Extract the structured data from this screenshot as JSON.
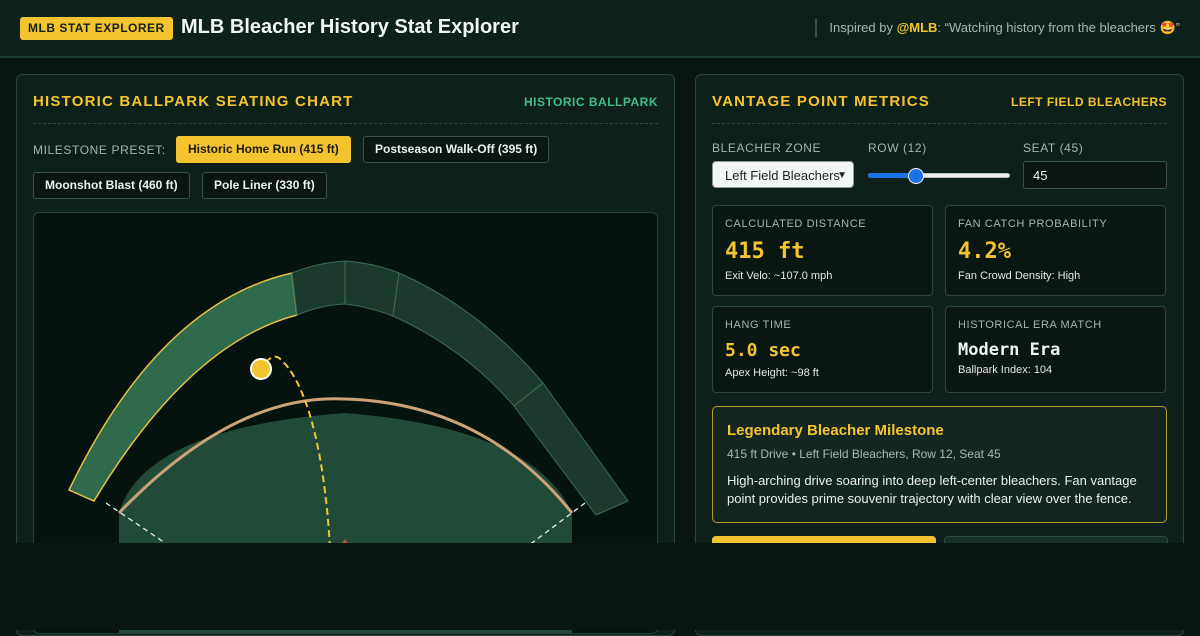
{
  "header": {
    "badge": "MLB STAT EXPLORER",
    "title": "MLB Bleacher History Stat Explorer",
    "inspired_prefix": "Inspired by ",
    "inspired_handle": "@MLB",
    "inspired_quote": ": “Watching history from the bleachers 🤩”"
  },
  "left_panel": {
    "title": "HISTORIC BALLPARK SEATING CHART",
    "tag": "HISTORIC BALLPARK",
    "preset_label": "MILESTONE PRESET:",
    "presets": [
      {
        "label": "Historic Home Run (415 ft)",
        "active": true
      },
      {
        "label": "Postseason Walk-Off (395 ft)",
        "active": false
      },
      {
        "label": "Moonshot Blast (460 ft)",
        "active": false
      },
      {
        "label": "Pole Liner (330 ft)",
        "active": false
      }
    ]
  },
  "right_panel": {
    "title": "VANTAGE POINT METRICS",
    "tag": "LEFT FIELD BLEACHERS",
    "zone_label": "BLEACHER ZONE",
    "zone_value": "Left Field Bleachers",
    "row_label": "ROW (12)",
    "row_value": 12,
    "row_fraction": 0.33,
    "seat_label": "SEAT (45)",
    "seat_value": "45",
    "metrics": {
      "distance": {
        "label": "CALCULATED DISTANCE",
        "value": "415 ft",
        "sub": "Exit Velo: ~107.0 mph"
      },
      "catch": {
        "label": "FAN CATCH PROBABILITY",
        "value": "4.2%",
        "sub": "Fan Crowd Density: High"
      },
      "hang": {
        "label": "HANG TIME",
        "value": "5.0 sec",
        "sub": "Apex Height: ~98 ft"
      },
      "era": {
        "label": "HISTORICAL ERA MATCH",
        "value": "Modern Era",
        "sub": "Ballpark Index: 104"
      }
    },
    "milestone": {
      "title": "Legendary Bleacher Milestone",
      "meta": "415 ft Drive • Left Field Bleachers, Row 12, Seat 45",
      "desc": "High-arching drive soaring into deep left-center bleachers. Fan vantage point provides prime souvenir trajectory with clear view over the fence."
    }
  },
  "colors": {
    "accent": "#f4c430",
    "field_green": "#2a5843",
    "bleacher": "#1b3a2d",
    "bleacher_selected": "#2f6a4c",
    "warning_track": "#c9a27a"
  }
}
